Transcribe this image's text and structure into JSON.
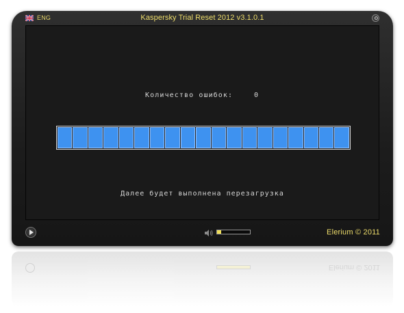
{
  "window": {
    "title": "Kaspersky Trial Reset 2012 v3.1.0.1",
    "language": "ENG"
  },
  "screen": {
    "errors_label": "Количество ошибок:",
    "errors_count": "0",
    "progress_fraction": 1.0,
    "progress_segments": 19,
    "status_message": "Далее будет выполнена перезагрузка"
  },
  "bottombar": {
    "volume_level": 0.12,
    "credit": "Elerium © 2011"
  },
  "colors": {
    "accent_text": "#f0df6c",
    "progress_fill": "#3e92f0"
  },
  "icons": {
    "flag": "uk-flag-icon",
    "power": "power-icon",
    "play": "play-icon",
    "speaker": "speaker-icon"
  }
}
